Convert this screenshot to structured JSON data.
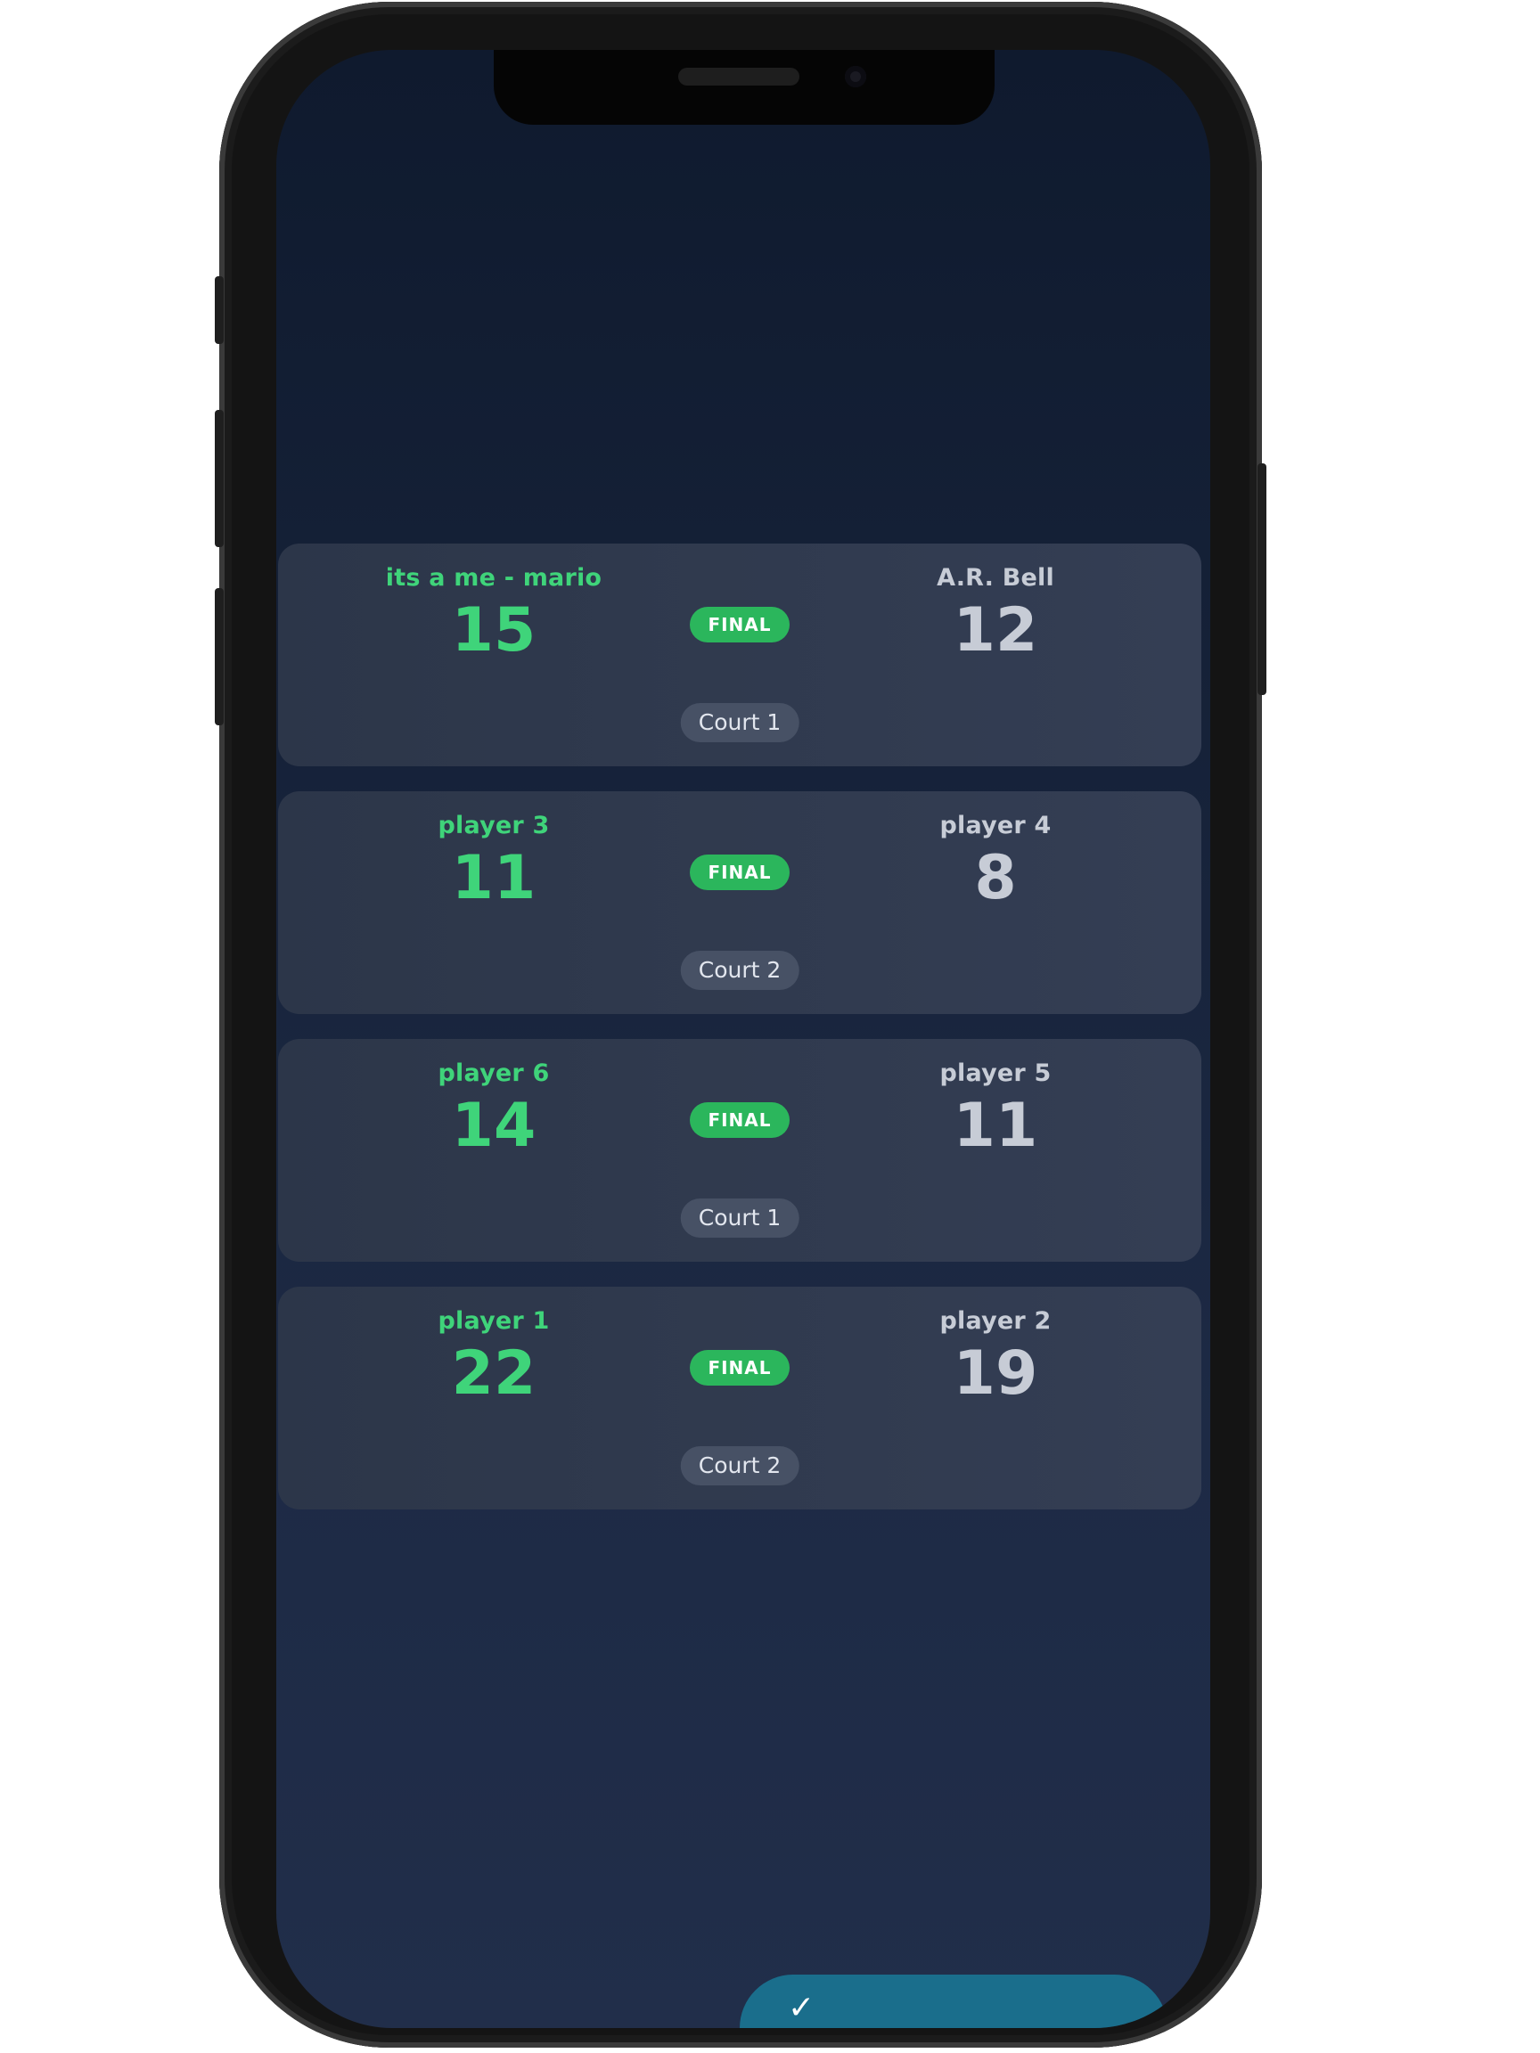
{
  "matches": [
    {
      "left": {
        "name": "its a me - mario",
        "score": "15"
      },
      "right": {
        "name": "A.R. Bell",
        "score": "12"
      },
      "status": "FINAL",
      "court": "Court 1"
    },
    {
      "left": {
        "name": "player 3",
        "score": "11"
      },
      "right": {
        "name": "player 4",
        "score": "8"
      },
      "status": "FINAL",
      "court": "Court 2"
    },
    {
      "left": {
        "name": "player 6",
        "score": "14"
      },
      "right": {
        "name": "player 5",
        "score": "11"
      },
      "status": "FINAL",
      "court": "Court 1"
    },
    {
      "left": {
        "name": "player 1",
        "score": "22"
      },
      "right": {
        "name": "player 2",
        "score": "19"
      },
      "status": "FINAL",
      "court": "Court 2"
    }
  ],
  "fab": {
    "icon": "check-icon"
  },
  "colors": {
    "winner": "#3fd47a",
    "loser": "#c7ccd6",
    "final_badge": "#2bb65c",
    "court_pill": "#475165",
    "card": "#2c3649",
    "fab": "#1a6e8c",
    "background_top": "#0f1a2e",
    "background_bottom": "#212e4a"
  }
}
